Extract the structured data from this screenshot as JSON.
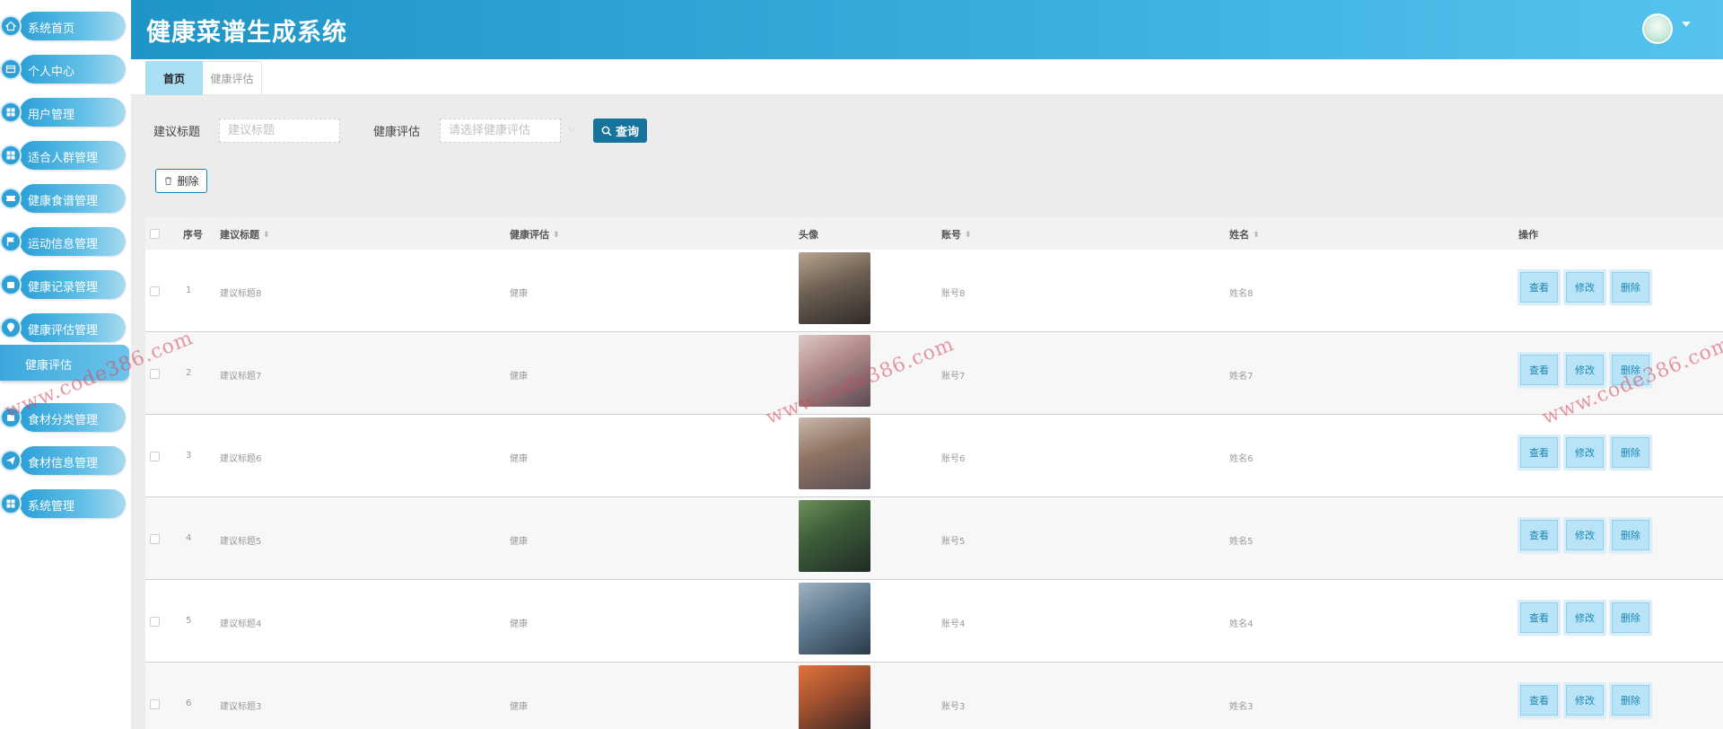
{
  "app": {
    "title": "健康菜谱生成系统"
  },
  "sidebar": {
    "items": [
      {
        "label": "系统首页",
        "icon": "home-icon"
      },
      {
        "label": "个人中心",
        "icon": "card-icon"
      },
      {
        "label": "用户管理",
        "icon": "grid-icon"
      },
      {
        "label": "适合人群管理",
        "icon": "grid-icon"
      },
      {
        "label": "健康食谱管理",
        "icon": "ticket-icon"
      },
      {
        "label": "运动信息管理",
        "icon": "flag-icon"
      },
      {
        "label": "健康记录管理",
        "icon": "box-icon"
      },
      {
        "label": "健康评估管理",
        "icon": "location-icon"
      },
      {
        "label": "食材分类管理",
        "icon": "box-icon"
      },
      {
        "label": "食材信息管理",
        "icon": "send-icon"
      },
      {
        "label": "系统管理",
        "icon": "grid-icon"
      }
    ],
    "active_sub_item": "健康评估"
  },
  "tabs": [
    {
      "label": "首页",
      "active": true
    },
    {
      "label": "健康评估",
      "active": false
    }
  ],
  "search": {
    "title_label": "建议标题",
    "title_placeholder": "建议标题",
    "assess_label": "健康评估",
    "assess_placeholder": "请选择健康评估",
    "query_button": "查询"
  },
  "toolbar": {
    "delete_button": "删除"
  },
  "table": {
    "columns": [
      "序号",
      "建议标题",
      "健康评估",
      "头像",
      "账号",
      "姓名",
      "操作"
    ],
    "rows": [
      {
        "index": "1",
        "title": "建议标题8",
        "assessment": "健康",
        "account": "账号8",
        "name": "姓名8"
      },
      {
        "index": "2",
        "title": "建议标题7",
        "assessment": "健康",
        "account": "账号7",
        "name": "姓名7"
      },
      {
        "index": "3",
        "title": "建议标题6",
        "assessment": "健康",
        "account": "账号6",
        "name": "姓名6"
      },
      {
        "index": "4",
        "title": "建议标题5",
        "assessment": "健康",
        "account": "账号5",
        "name": "姓名5"
      },
      {
        "index": "5",
        "title": "建议标题4",
        "assessment": "健康",
        "account": "账号4",
        "name": "姓名4"
      },
      {
        "index": "6",
        "title": "建议标题3",
        "assessment": "健康",
        "account": "账号3",
        "name": "姓名3"
      }
    ],
    "actions": {
      "view": "查看",
      "edit": "修改",
      "delete": "删除"
    }
  },
  "watermark": "www.code386.com",
  "colors": {
    "header": "#2aa5d6",
    "sidebar_pill": "#3aa9dc",
    "query_button": "#16739c",
    "action_button": "#b9e3f6",
    "watermark": "#d7465a"
  }
}
